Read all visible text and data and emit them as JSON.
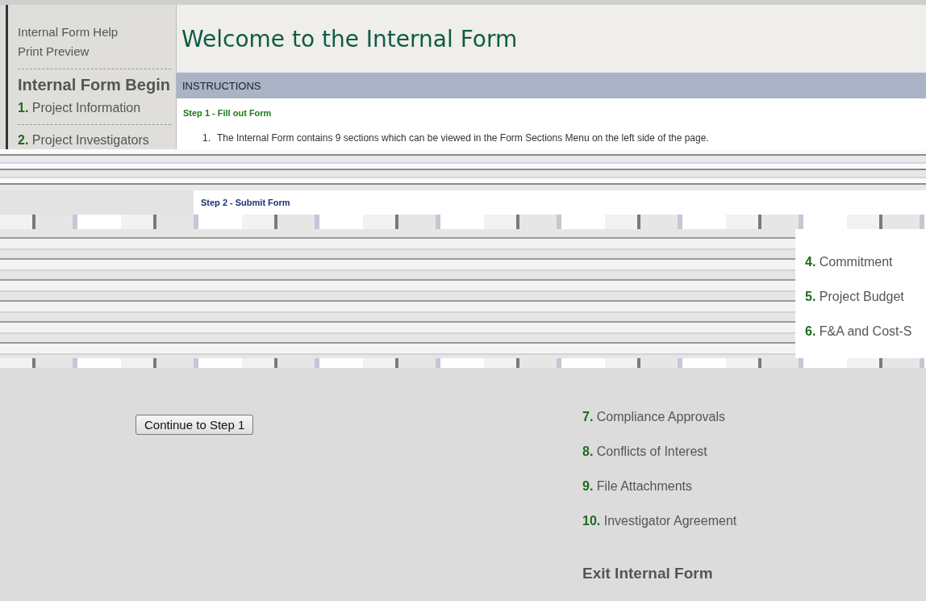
{
  "sidebar": {
    "links": [
      "Internal Form Help",
      "Print Preview"
    ],
    "heading": "Internal Form Begin",
    "sections_top": [
      {
        "number": "1.",
        "label": "Project Information"
      },
      {
        "number": "2.",
        "label": "Project Investigators"
      }
    ],
    "sections_right": [
      {
        "number": "4.",
        "label": "Commitment"
      },
      {
        "number": "5.",
        "label": "Project Budget"
      },
      {
        "number": "6.",
        "label": "F&A and Cost-S"
      }
    ],
    "sections_bottom": [
      {
        "number": "7.",
        "label": "Compliance Approvals"
      },
      {
        "number": "8.",
        "label": "Conflicts of Interest"
      },
      {
        "number": "9.",
        "label": "File Attachments"
      },
      {
        "number": "10.",
        "label": "Investigator Agreement"
      }
    ],
    "exit": "Exit Internal Form"
  },
  "main": {
    "title": "Welcome to the Internal Form",
    "bar": "INSTRUCTIONS",
    "step1": {
      "heading": "Step 1 - Fill out Form",
      "items": [
        {
          "number": "1.",
          "text": "The Internal Form contains 9 sections which can be viewed in the Form Sections Menu on the left side of the page."
        }
      ]
    },
    "step2": {
      "heading": "Step 2 - Submit Form"
    },
    "button": "Continue to Step 1"
  }
}
